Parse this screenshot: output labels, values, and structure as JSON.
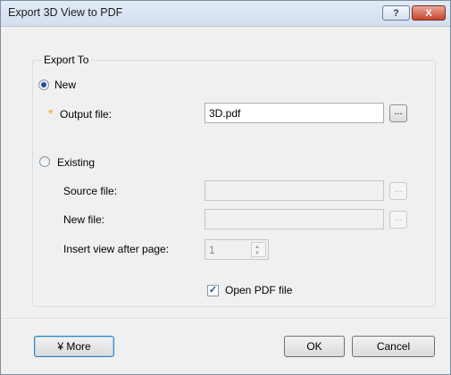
{
  "window": {
    "title": "Export 3D View to PDF",
    "help_glyph": "?",
    "close_glyph": "X"
  },
  "export_to": {
    "legend": "Export To",
    "new": {
      "label": "New",
      "selected": true
    },
    "output_file": {
      "required_mark": "*",
      "label": "Output file:",
      "value": "3D.pdf",
      "browse": "..."
    },
    "existing": {
      "label": "Existing",
      "selected": false
    },
    "source_file": {
      "label": "Source file:",
      "value": "",
      "browse": "..."
    },
    "new_file": {
      "label": "New file:",
      "value": "",
      "browse": "..."
    },
    "insert_after": {
      "label": "Insert view after page:",
      "value": "1"
    },
    "open_pdf": {
      "label": "Open PDF file",
      "checked": true,
      "mark": "✓"
    }
  },
  "footer": {
    "more": "¥ More",
    "ok": "OK",
    "cancel": "Cancel"
  },
  "colors": {
    "accent": "#1c4fa3",
    "required": "#f2a31b",
    "close_red": "#c7442c"
  }
}
